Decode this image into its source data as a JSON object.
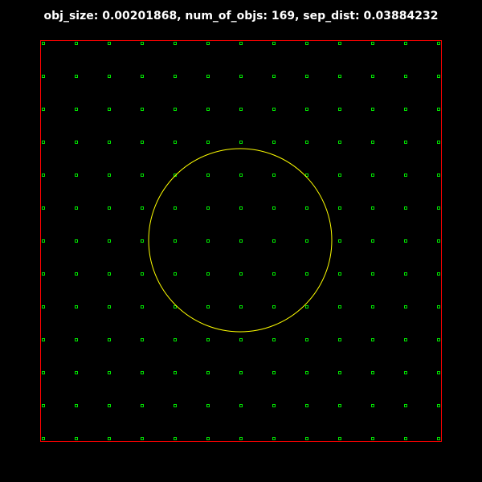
{
  "header": {
    "title": "obj_size: 0.00201868, num_of_objs: 169, sep_dist: 0.03884232"
  },
  "scene": {
    "grid": {
      "rows": 13,
      "cols": 13
    },
    "colors": {
      "background": "#000000",
      "boundary": "#ff0000",
      "objects": "#00ff00",
      "circle": "#ffff00"
    }
  }
}
